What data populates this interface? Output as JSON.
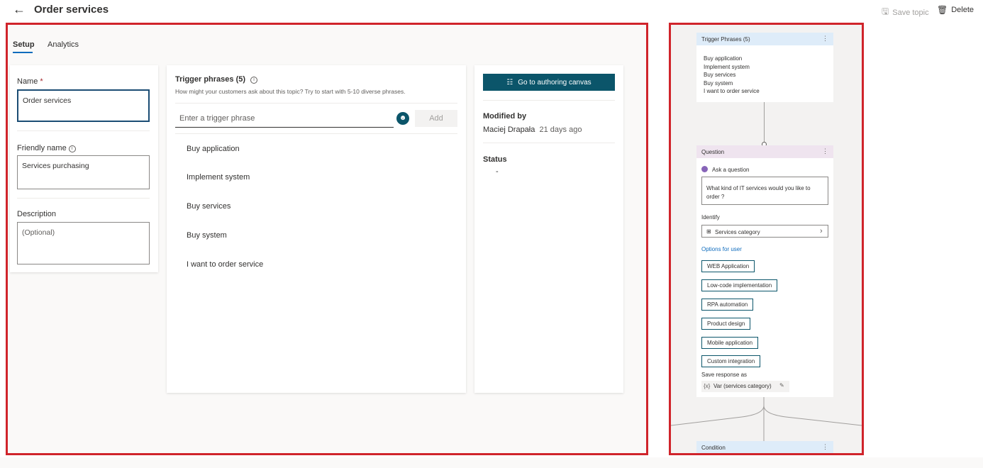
{
  "header": {
    "title": "Order services",
    "save_label": "Save topic",
    "delete_label": "Delete"
  },
  "tabs": [
    {
      "label": "Setup",
      "active": true
    },
    {
      "label": "Analytics",
      "active": false
    }
  ],
  "details": {
    "name_label": "Name",
    "name_required": "*",
    "name_value": "Order services",
    "friendly_label": "Friendly name",
    "friendly_value": "Services purchasing",
    "description_label": "Description",
    "description_placeholder": "(Optional)"
  },
  "trigger": {
    "title": "Trigger phrases (5)",
    "hint": "How might your customers ask about this topic? Try to start with 5-10 diverse phrases.",
    "input_placeholder": "Enter a trigger phrase",
    "add_label": "Add",
    "phrases": [
      "Buy application",
      "Implement system",
      "Buy services",
      "Buy system",
      "I want to order service"
    ]
  },
  "meta": {
    "canvas_button": "Go to authoring canvas",
    "modified_label": "Modified by",
    "modified_user": "Maciej Drapała",
    "modified_when": "21 days ago",
    "status_label": "Status",
    "status_value": "-"
  },
  "canvas": {
    "trigger_node_title": "Trigger Phrases (5)",
    "trigger_phrases": [
      "Buy application",
      "Implement system",
      "Buy services",
      "Buy system",
      "I want to order service"
    ],
    "question_node_title": "Question",
    "ask_label": "Ask a question",
    "question_text": "What kind of IT services would you like to order ?",
    "identify_label": "Identify",
    "entity_label": "Services category",
    "options_label": "Options for user",
    "options": [
      "WEB Application",
      "Low-code implementation",
      "RPA automation",
      "Product design",
      "Mobile application",
      "Custom integration"
    ],
    "save_response_label": "Save response as",
    "variable_label": "Var (services category)",
    "condition_node_title": "Condition"
  },
  "colors": {
    "accent": "#0b556a",
    "highlight_frame": "#d0242b",
    "focus_border": "#1b4d74"
  },
  "icons": {
    "back": "←",
    "save": "🖫",
    "delete": "🗑",
    "info": "i",
    "more": "⋮",
    "chevron": "›",
    "variable": "{x}",
    "edit": "✎"
  }
}
